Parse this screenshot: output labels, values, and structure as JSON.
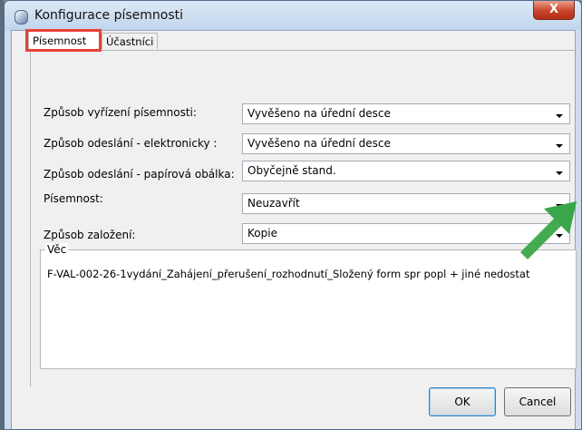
{
  "window": {
    "title": "Konfigurace písemnosti",
    "close_glyph": "X"
  },
  "tabs": [
    {
      "label": "Písemnost",
      "active": true
    },
    {
      "label": "Účastníci",
      "active": false
    }
  ],
  "form": {
    "rows": [
      {
        "label": "Způsob vyřízení písemnosti:",
        "value": "Vyvěšeno na úřední desce"
      },
      {
        "label": "Způsob odeslání - elektronicky :",
        "value": "Vyvěšeno na úřední desce"
      },
      {
        "label": "Způsob odeslání - papírová obálka:",
        "value": "Obyčejně stand."
      },
      {
        "label": "Písemnost:",
        "value": "Neuzavřít"
      },
      {
        "label": "Způsob založení:",
        "value": "Kopie"
      }
    ]
  },
  "subject": {
    "legend": "Věc",
    "text": "F-VAL-002-26-1vydání_Zahájení_přerušení_rozhodnutí_Složený form  spr  popl  + jiné nedostat"
  },
  "buttons": {
    "ok": "OK",
    "cancel": "Cancel"
  },
  "annotations": {
    "highlight_color": "#e9403a",
    "arrow_color": "#3aa64a"
  },
  "icons": {
    "window_icon": "app-globe-icon",
    "dropdown": "chevron-down-icon"
  }
}
